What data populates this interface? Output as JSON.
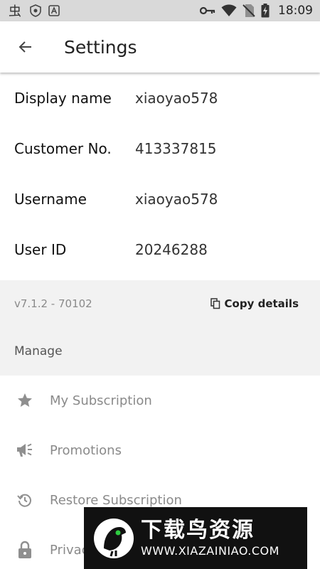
{
  "status_bar": {
    "time": "18:09",
    "left_icons": [
      "bug-icon",
      "shield-icon",
      "a-letter-icon"
    ],
    "right_icons": [
      "key-icon",
      "wifi-icon",
      "no-sim-icon",
      "battery-charging-icon"
    ]
  },
  "app_bar": {
    "title": "Settings",
    "back_icon": "arrow-left-icon"
  },
  "account_info": [
    {
      "label": "Display name",
      "value": "xiaoyao578"
    },
    {
      "label": "Customer No.",
      "value": "413337815"
    },
    {
      "label": "Username",
      "value": "xiaoyao578"
    },
    {
      "label": "User ID",
      "value": "20246288"
    }
  ],
  "meta": {
    "version": "v7.1.2 - 70102",
    "copy_label": "Copy details",
    "copy_icon": "copy-icon",
    "manage_header": "Manage"
  },
  "manage_items": [
    {
      "label": "My Subscription",
      "icon": "star-icon"
    },
    {
      "label": "Promotions",
      "icon": "megaphone-icon"
    },
    {
      "label": "Restore Subscription",
      "icon": "restore-icon"
    },
    {
      "label": "Privacy",
      "icon": "lock-icon"
    }
  ],
  "watermark": {
    "title": "下载鸟资源",
    "url": "WWW.XIAZAINIAO.COM"
  },
  "colors": {
    "status_bar_bg": "#d9d9d9",
    "meta_bg": "#f2f2f2",
    "muted_text": "#8a8a8a",
    "icon_gray": "#8f8f8f"
  }
}
